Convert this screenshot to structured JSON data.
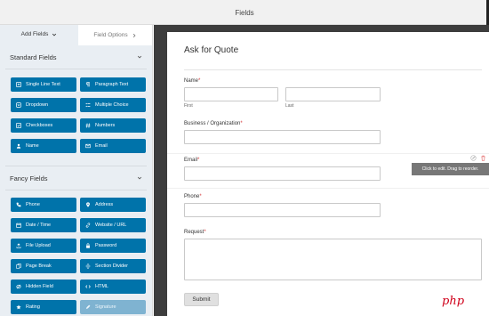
{
  "header": {
    "title": "Fields"
  },
  "sidebar": {
    "tabs": [
      {
        "label": "Add Fields"
      },
      {
        "label": "Field Options"
      }
    ],
    "standard": {
      "title": "Standard Fields",
      "buttons": [
        {
          "label": "Single Line Text",
          "icon": "text-icon"
        },
        {
          "label": "Paragraph Text",
          "icon": "paragraph-icon"
        },
        {
          "label": "Dropdown",
          "icon": "dropdown-icon"
        },
        {
          "label": "Multiple Choice",
          "icon": "list-icon"
        },
        {
          "label": "Checkboxes",
          "icon": "checkbox-icon"
        },
        {
          "label": "Numbers",
          "icon": "hash-icon"
        },
        {
          "label": "Name",
          "icon": "user-icon"
        },
        {
          "label": "Email",
          "icon": "envelope-icon"
        }
      ]
    },
    "fancy": {
      "title": "Fancy Fields",
      "buttons": [
        {
          "label": "Phone",
          "icon": "phone-icon"
        },
        {
          "label": "Address",
          "icon": "map-pin-icon"
        },
        {
          "label": "Date / Time",
          "icon": "calendar-icon"
        },
        {
          "label": "Website / URL",
          "icon": "link-icon"
        },
        {
          "label": "File Upload",
          "icon": "upload-icon"
        },
        {
          "label": "Password",
          "icon": "lock-icon"
        },
        {
          "label": "Page Break",
          "icon": "pages-icon"
        },
        {
          "label": "Section Divider",
          "icon": "divider-icon"
        },
        {
          "label": "Hidden Field",
          "icon": "eye-slash-icon"
        },
        {
          "label": "HTML",
          "icon": "code-icon"
        },
        {
          "label": "Rating",
          "icon": "star-icon"
        },
        {
          "label": "Signature",
          "icon": "pen-icon",
          "disabled": true
        }
      ]
    }
  },
  "form": {
    "title": "Ask for Quote",
    "name": {
      "label": "Name",
      "first": "First",
      "last": "Last"
    },
    "business": {
      "label": "Business / Organization"
    },
    "email": {
      "label": "Email"
    },
    "phone": {
      "label": "Phone"
    },
    "request": {
      "label": "Request"
    },
    "required_mark": "*",
    "hint": "Click to edit. Drag to reorder.",
    "submit": "Submit"
  },
  "watermark": "php",
  "colors": {
    "button": "#0073aa",
    "required": "#d63638",
    "canvas_bg": "#3d3d3d"
  }
}
